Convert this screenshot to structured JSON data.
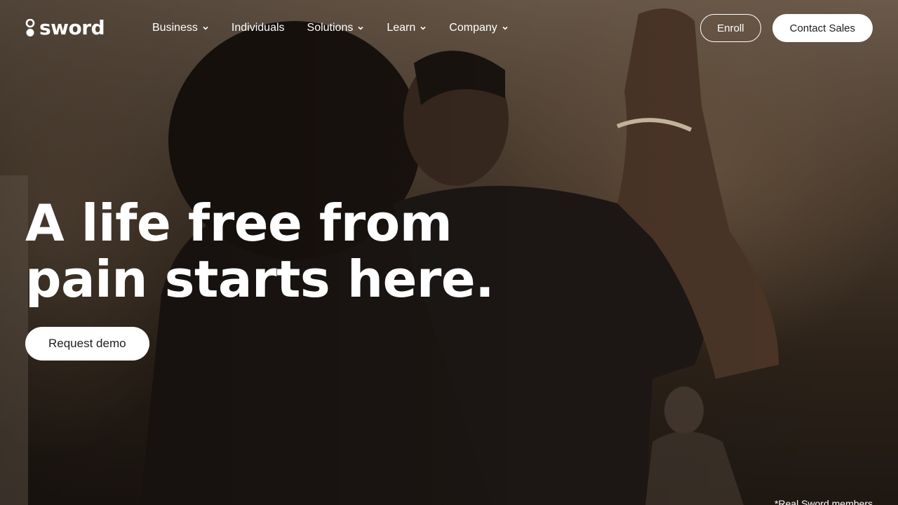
{
  "brand": {
    "name": "sword"
  },
  "nav": {
    "items": [
      {
        "label": "Business",
        "has_dropdown": true
      },
      {
        "label": "Individuals",
        "has_dropdown": false
      },
      {
        "label": "Solutions",
        "has_dropdown": true
      },
      {
        "label": "Learn",
        "has_dropdown": true
      },
      {
        "label": "Company",
        "has_dropdown": true
      }
    ]
  },
  "header": {
    "enroll_label": "Enroll",
    "contact_label": "Contact Sales"
  },
  "hero": {
    "title_line1": "A life free from",
    "title_line2": "pain starts here.",
    "cta_label": "Request demo",
    "footnote": "*Real Sword members"
  },
  "icons": {
    "logo": "sword-logo-icon",
    "chevron": "chevron-down-icon"
  },
  "colors": {
    "text": "#ffffff",
    "button_bg": "#ffffff",
    "button_text": "#1d1d1d"
  }
}
